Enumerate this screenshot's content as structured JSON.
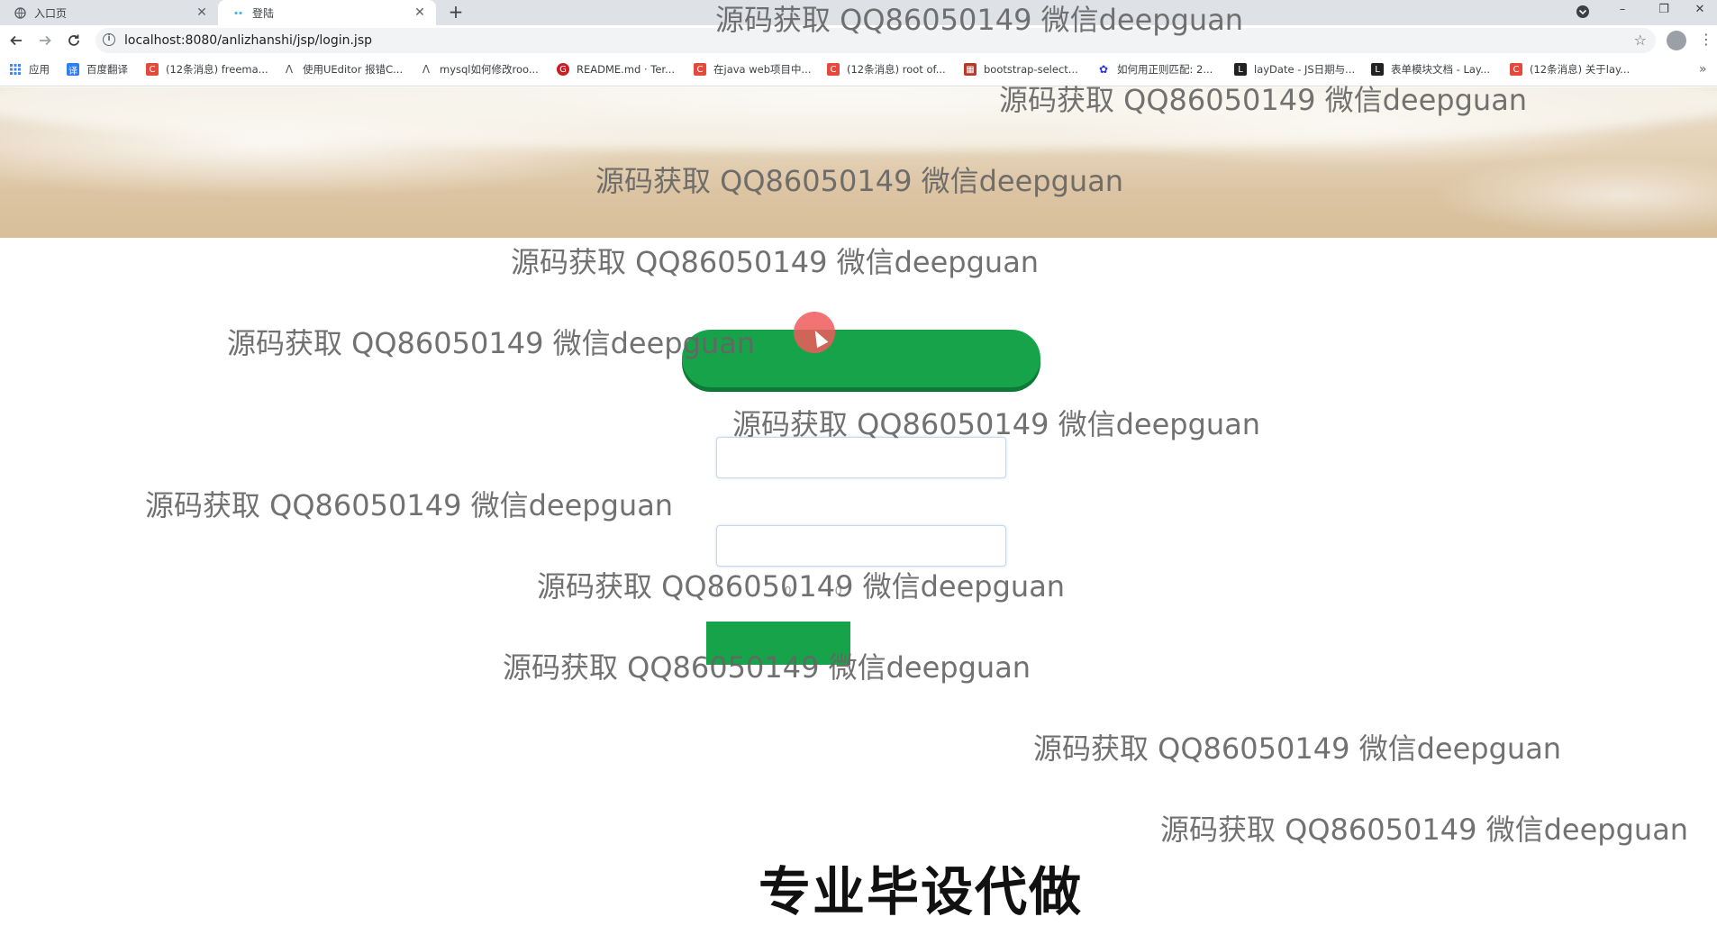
{
  "browser": {
    "tabs": [
      {
        "title": "入口页"
      },
      {
        "title": "登陆"
      }
    ],
    "new_tab_glyph": "+",
    "close_glyph": "✕",
    "window_controls": [
      "–",
      "❐",
      "✕"
    ],
    "address": "localhost:8080/anlizhanshi/jsp/login.jsp",
    "bookmarks": [
      {
        "label": "应用",
        "icon": "apps-grid-icon",
        "color": "#4285f4"
      },
      {
        "label": "百度翻译",
        "icon": "baidu-translate-icon",
        "color": "#2d7df6"
      },
      {
        "label": "(12条消息) freema...",
        "icon": "csdn-icon",
        "color": "#e4493b"
      },
      {
        "label": "使用UEditor 报错C...",
        "icon": "bird-icon",
        "color": "#555555"
      },
      {
        "label": "mysql如何修改roo...",
        "icon": "bird-icon",
        "color": "#555555"
      },
      {
        "label": "README.md · Ter...",
        "icon": "gitee-icon",
        "color": "#c71d23"
      },
      {
        "label": "在java web项目中...",
        "icon": "csdn-icon",
        "color": "#e4493b"
      },
      {
        "label": "(12条消息) root of...",
        "icon": "csdn-icon",
        "color": "#e4493b"
      },
      {
        "label": "bootstrap-select...",
        "icon": "cnblogs-icon",
        "color": "#b33b2e"
      },
      {
        "label": "如何用正则匹配: 2...",
        "icon": "baidu-paw-icon",
        "color": "#2932e1"
      },
      {
        "label": "layDate - JS日期与...",
        "icon": "layui-icon",
        "color": "#222222"
      },
      {
        "label": "表单模块文档 - Lay...",
        "icon": "layui-icon",
        "color": "#222222"
      },
      {
        "label": "(12条消息) 关于lay...",
        "icon": "csdn-icon",
        "color": "#e4493b"
      }
    ]
  },
  "page": {
    "accent_color": "#16a34a",
    "username_value": "",
    "password_value": "",
    "captcha_glyphs": [
      "0",
      "0",
      "0"
    ]
  },
  "overlay": {
    "watermark_text": "源码获取 QQ86050149 微信deepguan",
    "promo_text": "专业毕设代做"
  }
}
